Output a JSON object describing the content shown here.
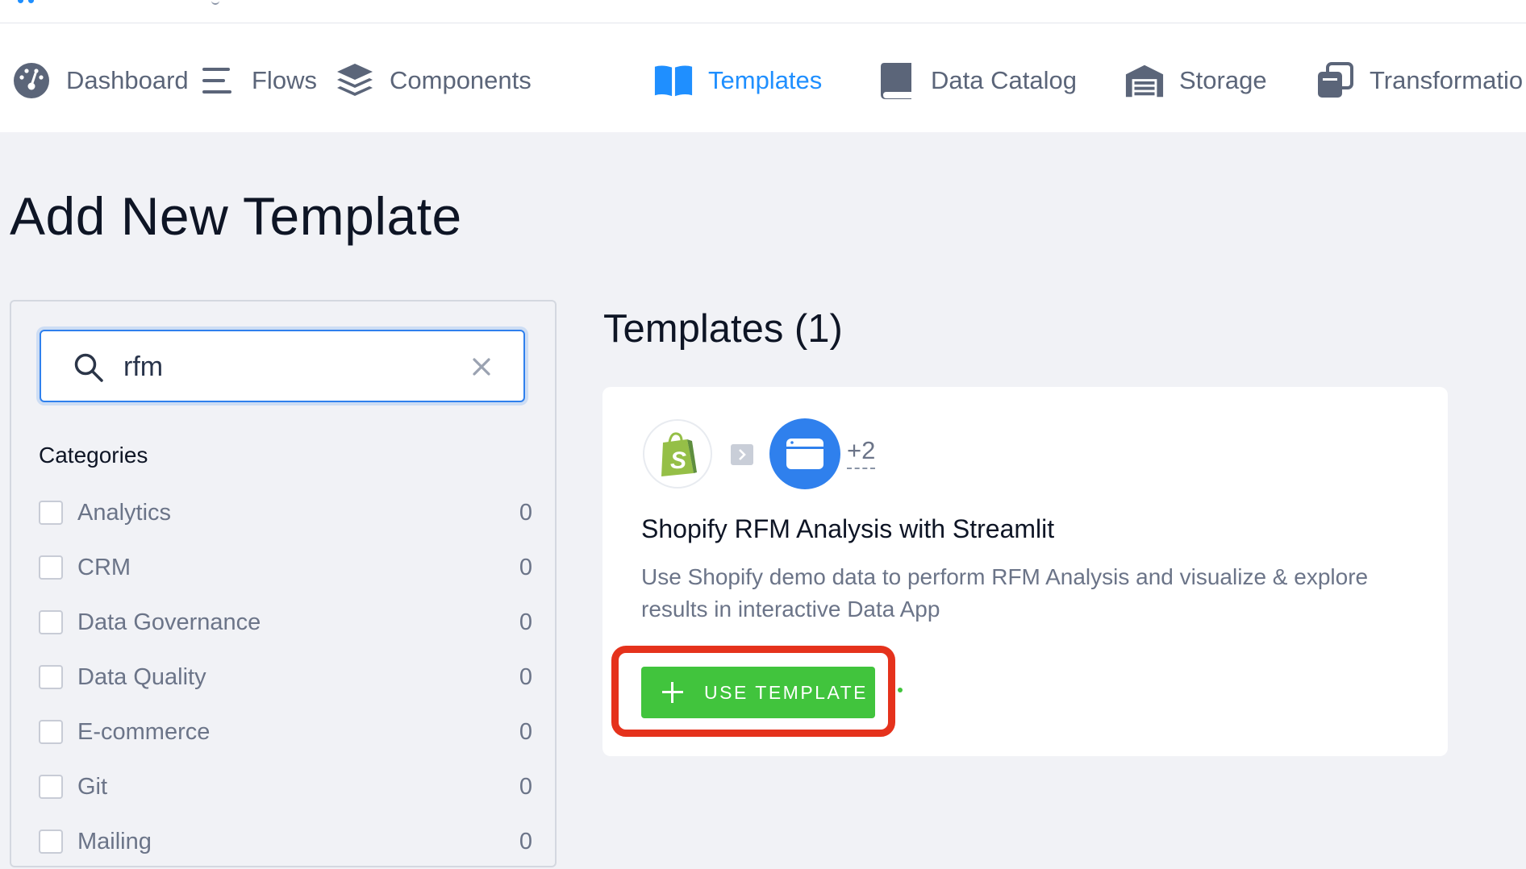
{
  "nav": {
    "items": [
      {
        "label": "Dashboard",
        "icon": "dashboard-icon",
        "active": false
      },
      {
        "label": "Flows",
        "icon": "flows-icon",
        "active": false
      },
      {
        "label": "Components",
        "icon": "layers-icon",
        "active": false
      },
      {
        "label": "Templates",
        "icon": "book-icon",
        "active": true
      },
      {
        "label": "Data Catalog",
        "icon": "catalog-book-icon",
        "active": false
      },
      {
        "label": "Storage",
        "icon": "warehouse-icon",
        "active": false
      },
      {
        "label": "Transformatio",
        "icon": "transformations-icon",
        "active": false
      }
    ]
  },
  "page": {
    "title": "Add New Template"
  },
  "search": {
    "value": "rfm",
    "icon": "search-icon",
    "clear_icon": "close-icon"
  },
  "categories": {
    "title": "Categories",
    "items": [
      {
        "label": "Analytics",
        "count": "0"
      },
      {
        "label": "CRM",
        "count": "0"
      },
      {
        "label": "Data Governance",
        "count": "0"
      },
      {
        "label": "Data Quality",
        "count": "0"
      },
      {
        "label": "E-commerce",
        "count": "0"
      },
      {
        "label": "Git",
        "count": "0"
      },
      {
        "label": "Mailing",
        "count": "0"
      }
    ]
  },
  "results": {
    "title": "Templates (1)",
    "templates": [
      {
        "name": "Shopify RFM Analysis with Streamlit",
        "description": "Use Shopify demo data to perform RFM Analysis and visualize & explore results in interactive Data App",
        "extra_components": "+2",
        "button_label": "USE TEMPLATE",
        "icons": [
          "shopify-logo-icon",
          "arrow-right-icon",
          "data-app-icon"
        ]
      }
    ]
  },
  "colors": {
    "accent": "#1f8fff",
    "button_green": "#41c43d",
    "highlight_red": "#e5321c",
    "background": "#f1f2f6"
  }
}
